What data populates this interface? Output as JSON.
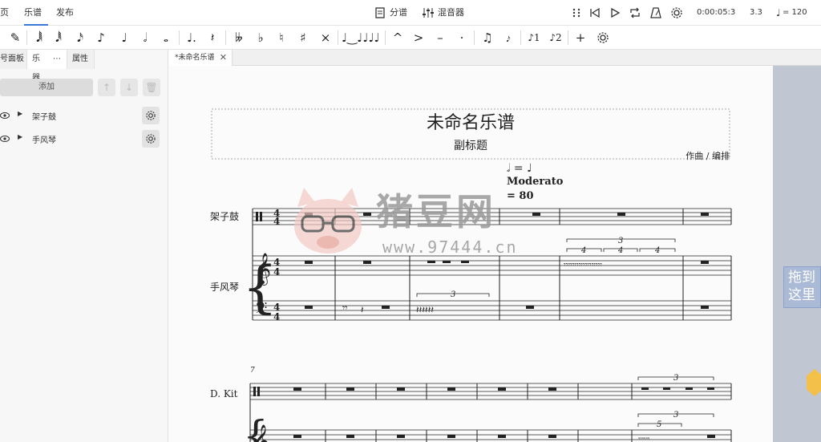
{
  "menu": {
    "tabs": [
      "页",
      "乐谱",
      "发布"
    ],
    "active": "乐谱"
  },
  "top_center": {
    "parts_label": "分谱",
    "mixer_label": "混音器"
  },
  "transport": {
    "time": "0:00:05:3",
    "position": "3.3",
    "tempo": "= 120"
  },
  "left_panel": {
    "tabs": [
      "号面板",
      "乐器",
      "⋯",
      "属性"
    ],
    "add_label": "添加",
    "instruments": [
      {
        "name": "架子鼓"
      },
      {
        "name": "手风琴"
      }
    ]
  },
  "document": {
    "tab_title": "*未命名乐谱"
  },
  "score": {
    "title": "未命名乐谱",
    "subtitle": "副标题",
    "composer": "作曲 / 编排",
    "tempo_mod": "𝅗𝅥 = ♩",
    "tempo_text": "Moderato",
    "tempo_value": "= 80",
    "staff_labels": [
      "架子鼓",
      "手风琴"
    ],
    "measure_number": "7",
    "kit_label": "D. Kit",
    "tuplets": [
      "3",
      "4",
      "4",
      "4",
      "3",
      "3",
      "3",
      "5"
    ]
  },
  "watermark": {
    "title": "猪豆网",
    "url": "www.97444.cn"
  },
  "drop_hint": "拖到这里",
  "colors": {
    "accent": "#3a78d6",
    "gutter": "#c0c6d2",
    "drop": "#a9b9d6"
  }
}
